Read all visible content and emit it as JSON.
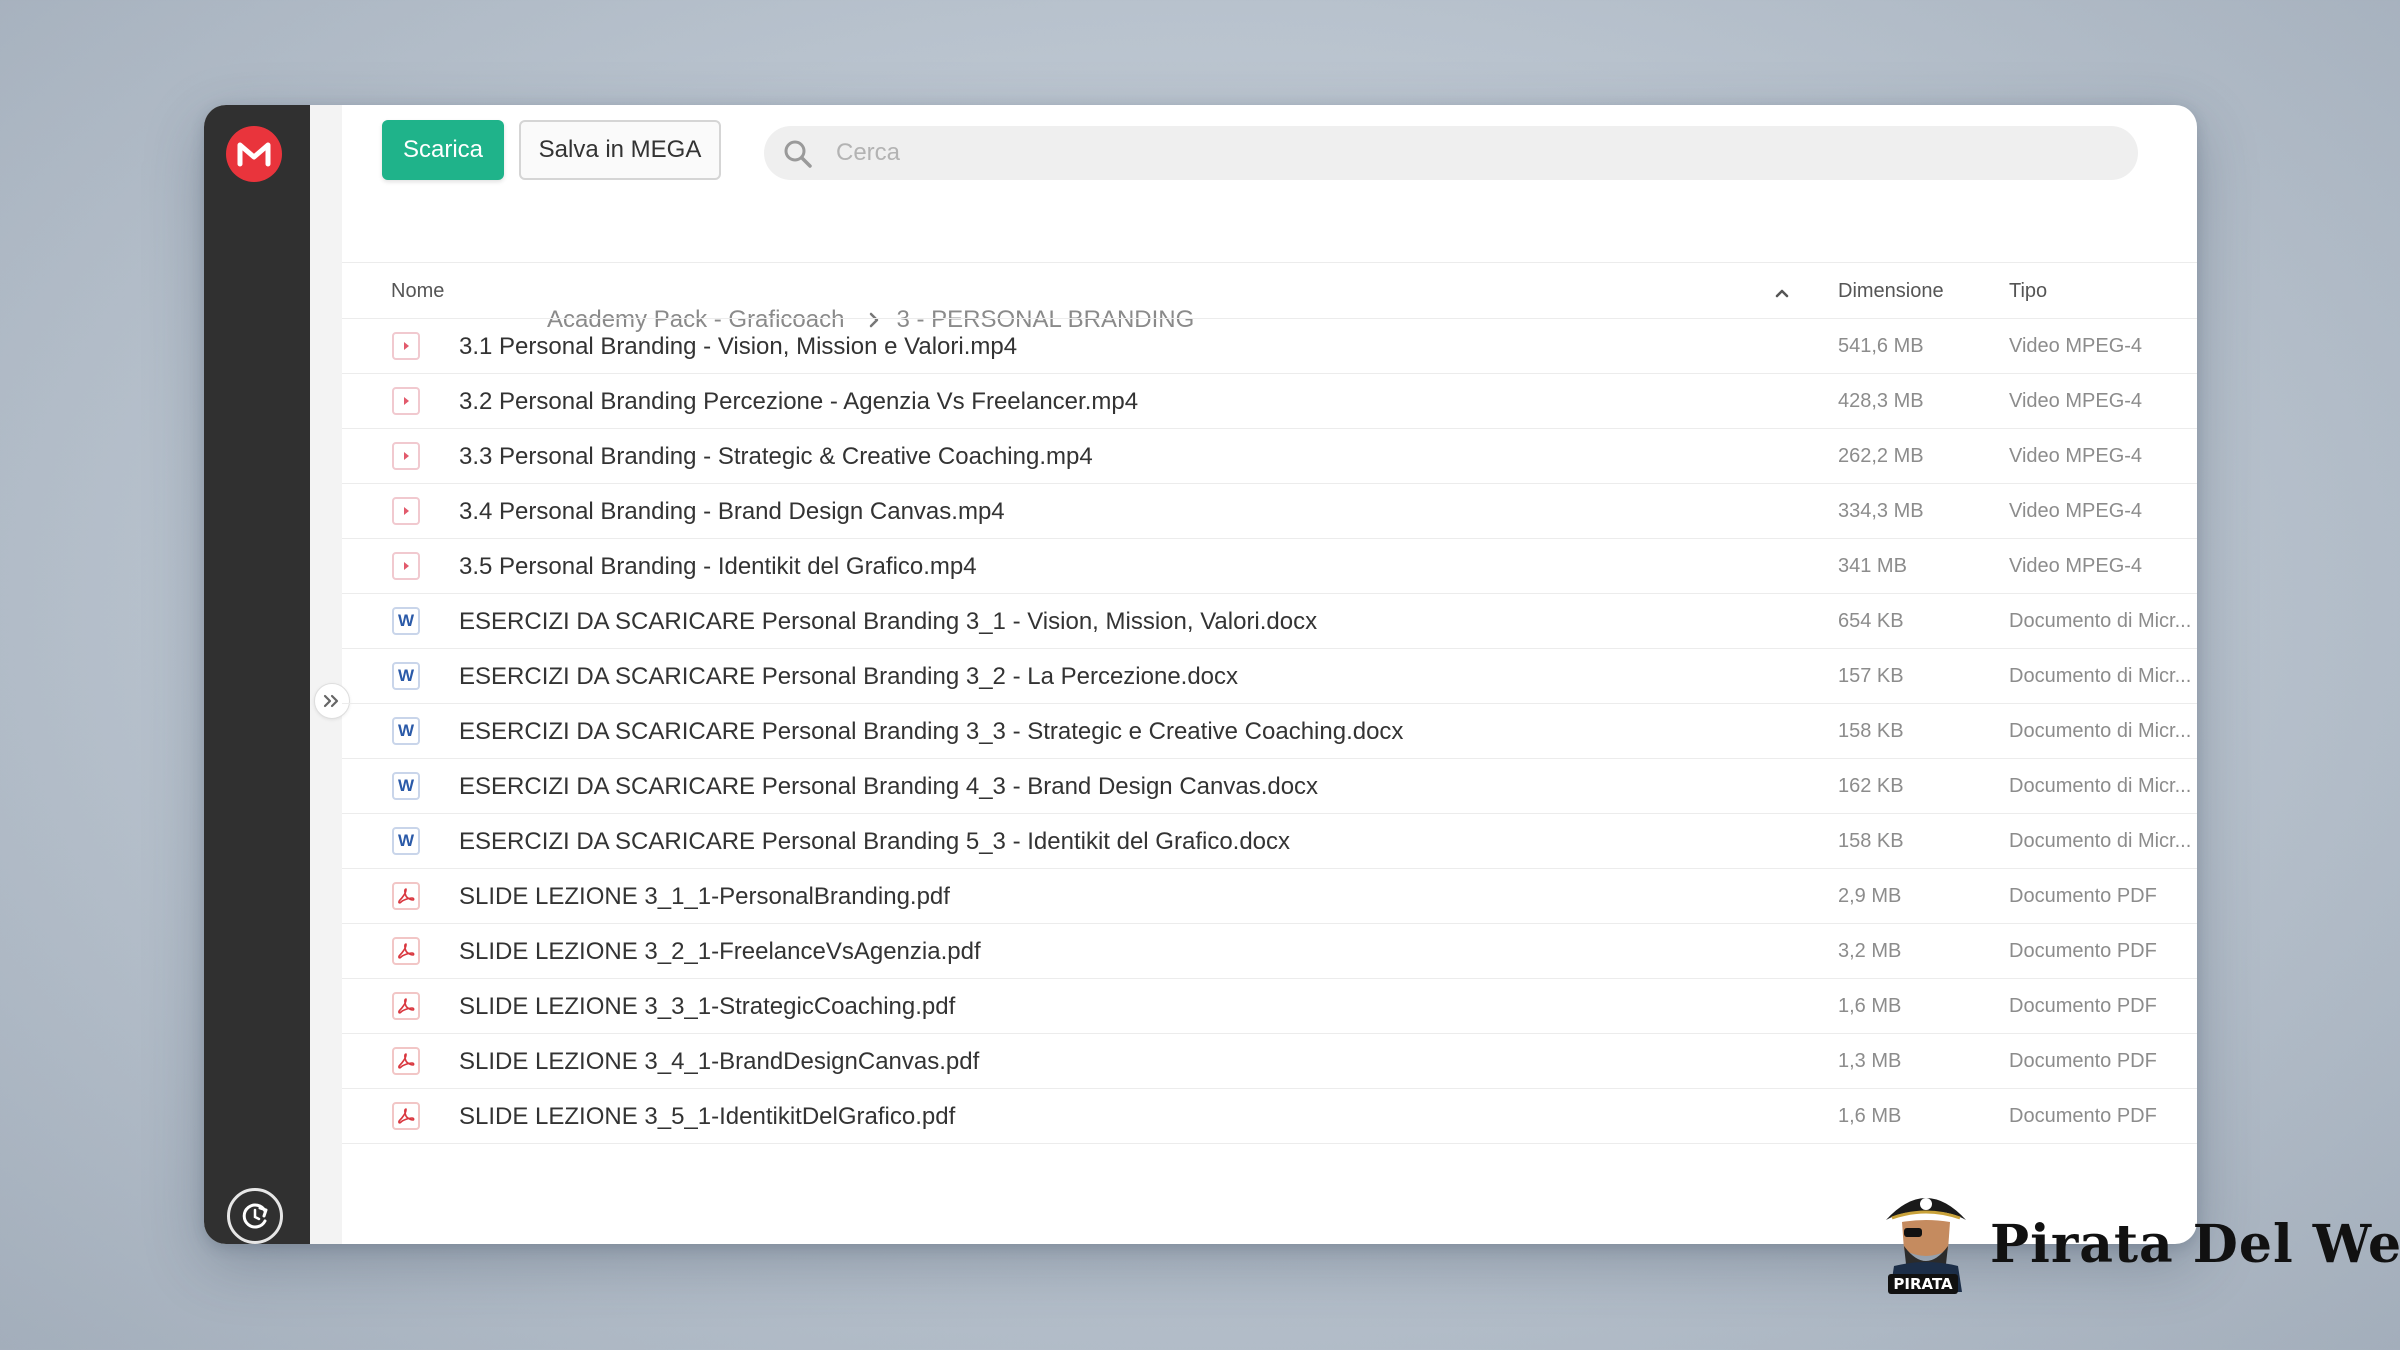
{
  "toolbar": {
    "download_label": "Scarica",
    "save_label": "Salva in MEGA"
  },
  "search": {
    "placeholder": "Cerca",
    "value": ""
  },
  "breadcrumb": {
    "items": [
      "Academy Pack - Graficoach",
      "3 - PERSONAL BRANDING"
    ]
  },
  "table": {
    "headers": {
      "name": "Nome",
      "size": "Dimensione",
      "type": "Tipo"
    },
    "sort": "name-ascending",
    "rows": [
      {
        "icon": "video-file-icon",
        "name": "3.1 Personal Branding - Vision, Mission e Valori.mp4",
        "size": "541,6 MB",
        "type": "Video MPEG-4"
      },
      {
        "icon": "video-file-icon",
        "name": "3.2 Personal Branding Percezione - Agenzia Vs Freelancer.mp4",
        "size": "428,3 MB",
        "type": "Video MPEG-4"
      },
      {
        "icon": "video-file-icon",
        "name": "3.3 Personal Branding - Strategic & Creative Coaching.mp4",
        "size": "262,2 MB",
        "type": "Video MPEG-4"
      },
      {
        "icon": "video-file-icon",
        "name": "3.4 Personal Branding - Brand Design Canvas.mp4",
        "size": "334,3 MB",
        "type": "Video MPEG-4"
      },
      {
        "icon": "video-file-icon",
        "name": "3.5 Personal Branding - Identikit del Grafico.mp4",
        "size": "341 MB",
        "type": "Video MPEG-4"
      },
      {
        "icon": "word-file-icon",
        "name": "ESERCIZI DA SCARICARE Personal Branding 3_1 - Vision, Mission, Valori.docx",
        "size": "654 KB",
        "type": "Documento di Micr..."
      },
      {
        "icon": "word-file-icon",
        "name": "ESERCIZI DA SCARICARE Personal Branding 3_2 - La Percezione.docx",
        "size": "157 KB",
        "type": "Documento di Micr..."
      },
      {
        "icon": "word-file-icon",
        "name": "ESERCIZI DA SCARICARE Personal Branding 3_3 - Strategic e Creative Coaching.docx",
        "size": "158 KB",
        "type": "Documento di Micr..."
      },
      {
        "icon": "word-file-icon",
        "name": "ESERCIZI DA SCARICARE Personal Branding 4_3 - Brand Design Canvas.docx",
        "size": "162 KB",
        "type": "Documento di Micr..."
      },
      {
        "icon": "word-file-icon",
        "name": "ESERCIZI DA SCARICARE Personal Branding 5_3 - Identikit del Grafico.docx",
        "size": "158 KB",
        "type": "Documento di Micr..."
      },
      {
        "icon": "pdf-file-icon",
        "name": "SLIDE LEZIONE 3_1_1-PersonalBranding.pdf",
        "size": "2,9 MB",
        "type": "Documento PDF"
      },
      {
        "icon": "pdf-file-icon",
        "name": "SLIDE LEZIONE 3_2_1-FreelanceVsAgenzia.pdf",
        "size": "3,2 MB",
        "type": "Documento PDF"
      },
      {
        "icon": "pdf-file-icon",
        "name": "SLIDE LEZIONE 3_3_1-StrategicCoaching.pdf",
        "size": "1,6 MB",
        "type": "Documento PDF"
      },
      {
        "icon": "pdf-file-icon",
        "name": "SLIDE LEZIONE 3_4_1-BrandDesignCanvas.pdf",
        "size": "1,3 MB",
        "type": "Documento PDF"
      },
      {
        "icon": "pdf-file-icon",
        "name": "SLIDE LEZIONE 3_5_1-IdentikitDelGrafico.pdf",
        "size": "1,6 MB",
        "type": "Documento PDF"
      }
    ]
  },
  "sidebar": {
    "logo_icon": "mega-logo-icon",
    "bottom_icon": "sync-icon",
    "expand_icon": "double-chevron-right-icon"
  },
  "watermark": {
    "brand_text": "Pirata Del Web",
    "mascot_label": "PIRATA"
  },
  "colors": {
    "accent_green": "#1fb38a",
    "mega_red": "#e9343c",
    "sidebar_dark": "#303030"
  }
}
